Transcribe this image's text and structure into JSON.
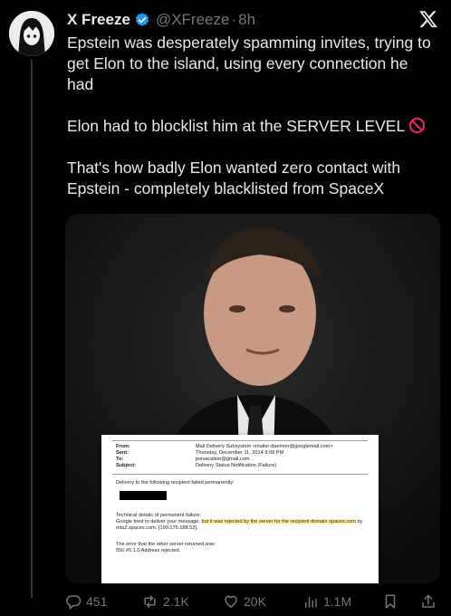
{
  "author": {
    "name": "X Freeze",
    "handle": "@XFreeze",
    "separator": "·",
    "time": "8h"
  },
  "tweet": {
    "paragraphs": [
      "Epstein was desperately spamming invites, trying to get Elon to the island, using every connection he had",
      "Elon had to blocklist him at the SERVER LEVEL",
      "That's how badly Elon wanted zero contact with Epstein - completely blacklisted from SpaceX"
    ]
  },
  "email": {
    "rows": [
      {
        "k": "From:",
        "v": "Mail Delivery Subsystem <mailer-daemon@googlemail.com>"
      },
      {
        "k": "Sent:",
        "v": "Thursday, December 11, 2014 9:09 PM"
      },
      {
        "k": "To:",
        "v": "jeevacation@gmail.com"
      },
      {
        "k": "Subject:",
        "v": "Delivery Status Notification (Failure)"
      }
    ],
    "intro": "Delivery to the following recipient failed permanently:",
    "tech_heading": "Technical details of permanent failure:",
    "tech_pre": "Google tried to deliver your message, ",
    "tech_highlight": "but it was rejected by the server for the recipient domain spacex.com",
    "tech_post": " by mta2.spacex.com. [199.175.188.52].",
    "error_heading": "The error that the other server returned was:",
    "error_code": "550 #5.1.0 Address rejected."
  },
  "actions": {
    "replies": "451",
    "reposts": "2.1K",
    "likes": "20K",
    "views": "1.1M"
  },
  "colors": {
    "background": "#000000",
    "text": "#e7e9ea",
    "muted": "#71767b",
    "verified": "#1d9bf0"
  }
}
